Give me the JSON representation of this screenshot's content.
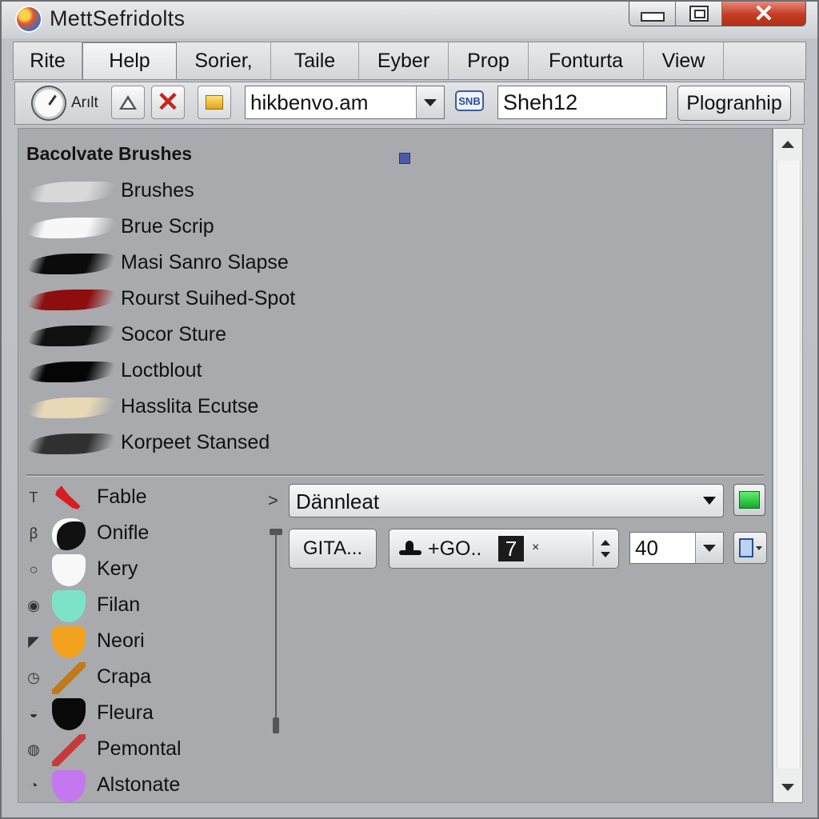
{
  "window": {
    "title": "MettSefridolts"
  },
  "menu": [
    "Rite",
    "Help",
    "Sorier,",
    "Taile",
    "Eyber",
    "Prop",
    "Fonturta",
    "View"
  ],
  "toolbar": {
    "gauge_label": "Arılt",
    "file_combo_value": "hikbenvo.am",
    "swap_label": "SNB",
    "name_value": "Sheh12",
    "apply_label": "Plogranhip"
  },
  "brushes": {
    "title": "Bacolvate Brushes",
    "items": [
      {
        "label": "Brushes",
        "color": "#d8d8d8"
      },
      {
        "label": "Brue Scrip",
        "color": "#f7f7f7"
      },
      {
        "label": "Masi Sanro Slapse",
        "color": "#0b0b0b"
      },
      {
        "label": "Rourst Suihed-Spot",
        "color": "#8e0d0d"
      },
      {
        "label": "Socor Sture",
        "color": "#101010"
      },
      {
        "label": "Loctblout",
        "color": "#050505"
      },
      {
        "label": "Hasslita Ecutse",
        "color": "#e8d9b6"
      },
      {
        "label": "Korpeet Stansed",
        "color": "#303030"
      }
    ]
  },
  "tools": [
    {
      "label": "Fable",
      "small_icon": "T",
      "shape": "feather",
      "color": "#d81d22"
    },
    {
      "label": "Onifle",
      "small_icon": "ꞵ",
      "shape": "blob",
      "color": "#111111"
    },
    {
      "label": "Kery",
      "small_icon": "○",
      "shape": "shield",
      "color": "#f8f8f8"
    },
    {
      "label": "Filan",
      "small_icon": "◉",
      "shape": "shield",
      "color": "#7de3c8"
    },
    {
      "label": "Neori",
      "small_icon": "◤",
      "shape": "shield",
      "color": "#f2a11f"
    },
    {
      "label": "Crapa",
      "small_icon": "◷",
      "shape": "brush",
      "color": "#c37a17"
    },
    {
      "label": "Fleura",
      "small_icon": "◒",
      "shape": "shield",
      "color": "#0a0a0a"
    },
    {
      "label": "Pemontal",
      "small_icon": "◍",
      "shape": "brush",
      "color": "#c83a3a"
    },
    {
      "label": "Alstonate",
      "small_icon": "◔",
      "shape": "shield",
      "color": "#c477ef"
    }
  ],
  "options": {
    "pane_arrow": ">",
    "blend_mode": "Dännleat",
    "gita_label": "GITA...",
    "go_label": "+GO..",
    "go_number": "7",
    "x_mark": "×",
    "size_value": "40"
  }
}
